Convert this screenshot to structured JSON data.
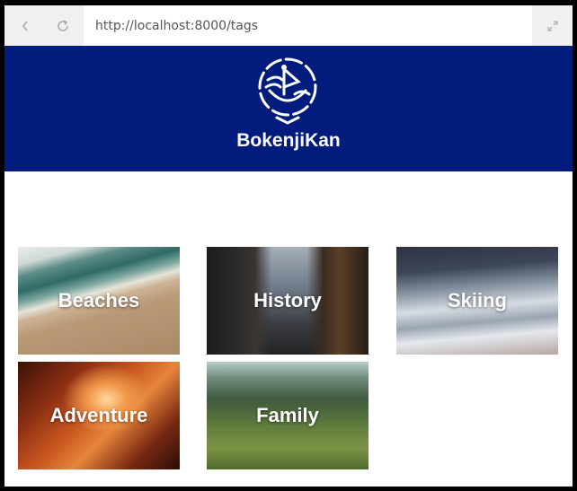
{
  "browser": {
    "url": "http://localhost:8000/tags",
    "back_icon": "chevron-left-icon",
    "reload_icon": "reload-icon",
    "expand_icon": "expand-icon"
  },
  "header": {
    "brand": "BokenjiKan",
    "logo_icon": "ship-globe-logo",
    "background_color": "#011c7d"
  },
  "tags": [
    {
      "label": "Beaches"
    },
    {
      "label": "History"
    },
    {
      "label": "Skiing"
    },
    {
      "label": "Adventure"
    },
    {
      "label": "Family"
    }
  ]
}
